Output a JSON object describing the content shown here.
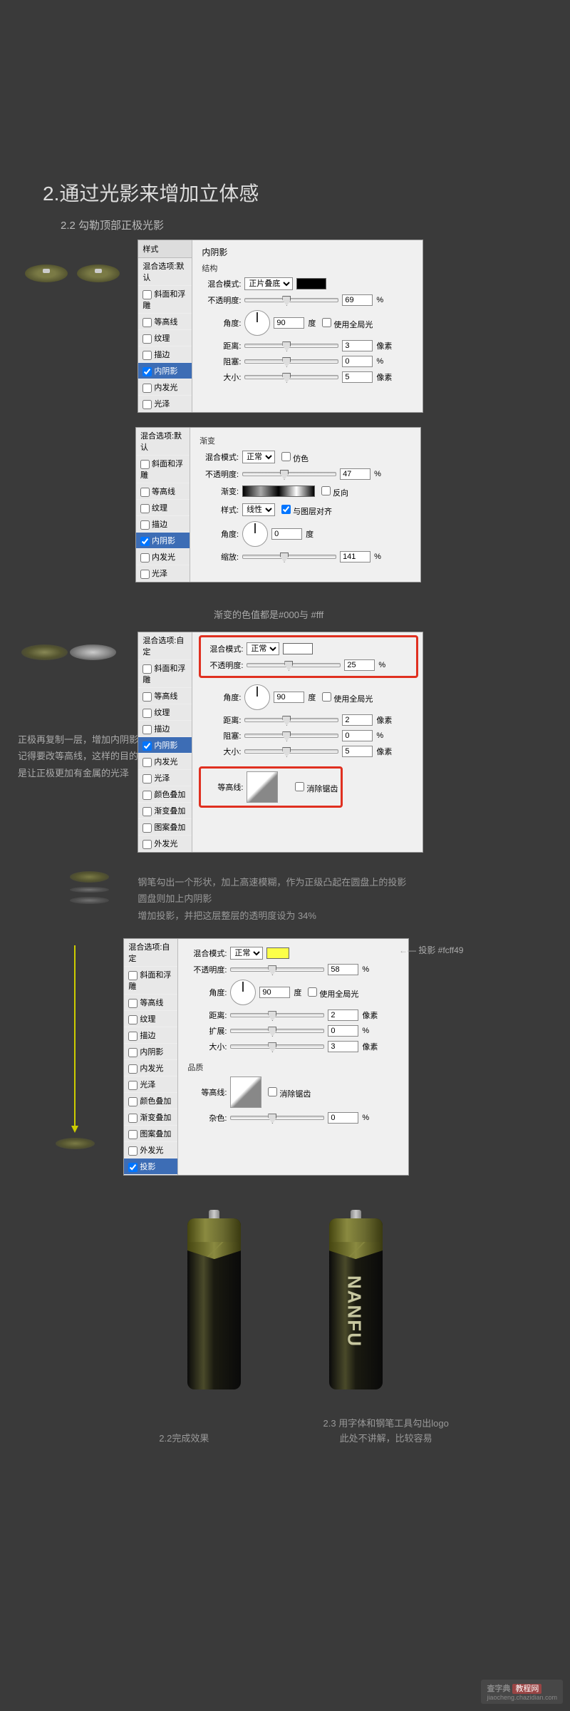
{
  "main_title": "2.通过光影来增加立体感",
  "sub_title": "2.2 勾勒顶部正极光影",
  "panel1": {
    "left_header": "样式",
    "blend_header": "混合选项:默认",
    "styles": [
      "斜面和浮雕",
      "等高线",
      "纹理",
      "描边",
      "内阴影",
      "内发光",
      "光泽"
    ],
    "checked_idx": 4,
    "right_header": "内阴影",
    "sub_header": "结构",
    "blend_mode_label": "混合模式:",
    "blend_mode_value": "正片叠底",
    "opacity_label": "不透明度:",
    "opacity_value": "69",
    "angle_label": "角度:",
    "angle_value": "90",
    "angle_unit": "度",
    "global_light": "使用全局光",
    "distance_label": "距离:",
    "distance_value": "3",
    "distance_unit": "像素",
    "choke_label": "阻塞:",
    "choke_value": "0",
    "size_label": "大小:",
    "size_value": "5",
    "size_unit": "像素"
  },
  "panel2": {
    "blend_header": "混合选项:默认",
    "styles": [
      "斜面和浮雕",
      "等高线",
      "纹理",
      "描边",
      "内阴影",
      "内发光",
      "光泽"
    ],
    "checked_idx": 4,
    "right_sub": "渐变",
    "blend_mode_label": "混合模式:",
    "blend_mode_value": "正常",
    "dither": "仿色",
    "opacity_label": "不透明度:",
    "opacity_value": "47",
    "gradient_label": "渐变:",
    "reverse": "反向",
    "style_label": "样式:",
    "style_value": "线性",
    "align_layer": "与图层对齐",
    "angle_label": "角度:",
    "angle_value": "0",
    "angle_unit": "度",
    "scale_label": "缩放:",
    "scale_value": "141"
  },
  "note1": "渐变的色值都是#000与 #fff",
  "panel3": {
    "blend_header": "混合选项:自定",
    "styles": [
      "斜面和浮雕",
      "等高线",
      "纹理",
      "描边",
      "内阴影",
      "内发光",
      "光泽",
      "颜色叠加",
      "渐变叠加",
      "图案叠加",
      "外发光"
    ],
    "checked_idx": 4,
    "blend_mode_label": "混合模式:",
    "blend_mode_value": "正常",
    "opacity_label": "不透明度:",
    "opacity_value": "25",
    "angle_label": "角度:",
    "angle_value": "90",
    "angle_unit": "度",
    "global_light": "使用全局光",
    "distance_label": "距离:",
    "distance_value": "2",
    "distance_unit": "像素",
    "choke_label": "阻塞:",
    "choke_value": "0",
    "size_label": "大小:",
    "size_value": "5",
    "size_unit": "像素",
    "contour_label": "等高线:",
    "antialias": "消除锯齿"
  },
  "sidenote1": "正极再复制一层，增加内阴影\n记得要改等高线，这样的目的\n是让正极更加有金属的光泽",
  "steel_text": "钢笔勾出一个形状，加上高速模糊，作为正级凸起在圆盘上的投影\n圆盘则加上内阴影\n增加投影，并把这层整层的透明度设为 34%",
  "panel4": {
    "blend_header": "混合选项:自定",
    "styles": [
      "斜面和浮雕",
      "等高线",
      "纹理",
      "描边",
      "内阴影",
      "内发光",
      "光泽",
      "颜色叠加",
      "渐变叠加",
      "图案叠加",
      "外发光",
      "投影"
    ],
    "checked_idx": 11,
    "blend_mode_label": "混合模式:",
    "blend_mode_value": "正常",
    "opacity_label": "不透明度:",
    "opacity_value": "58",
    "angle_label": "角度:",
    "angle_value": "90",
    "angle_unit": "度",
    "global_light": "使用全局光",
    "distance_label": "距离:",
    "distance_value": "2",
    "distance_unit": "像素",
    "spread_label": "扩展:",
    "spread_value": "0",
    "size_label": "大小:",
    "size_value": "3",
    "size_unit": "像素",
    "quality_header": "品质",
    "contour_label": "等高线:",
    "antialias": "消除锯齿",
    "noise_label": "杂色:",
    "noise_value": "0"
  },
  "yellow_note": "投影 #fcff49",
  "battery_brand": "NANFU",
  "caption1": "2.2完成效果",
  "caption2": "2.3 用字体和钢笔工具勾出logo\n此处不讲解，比较容易",
  "watermark_text": "查字典",
  "watermark_badge": "教程网",
  "watermark_url": "jiaocheng.chazidian.com",
  "pct": "%"
}
